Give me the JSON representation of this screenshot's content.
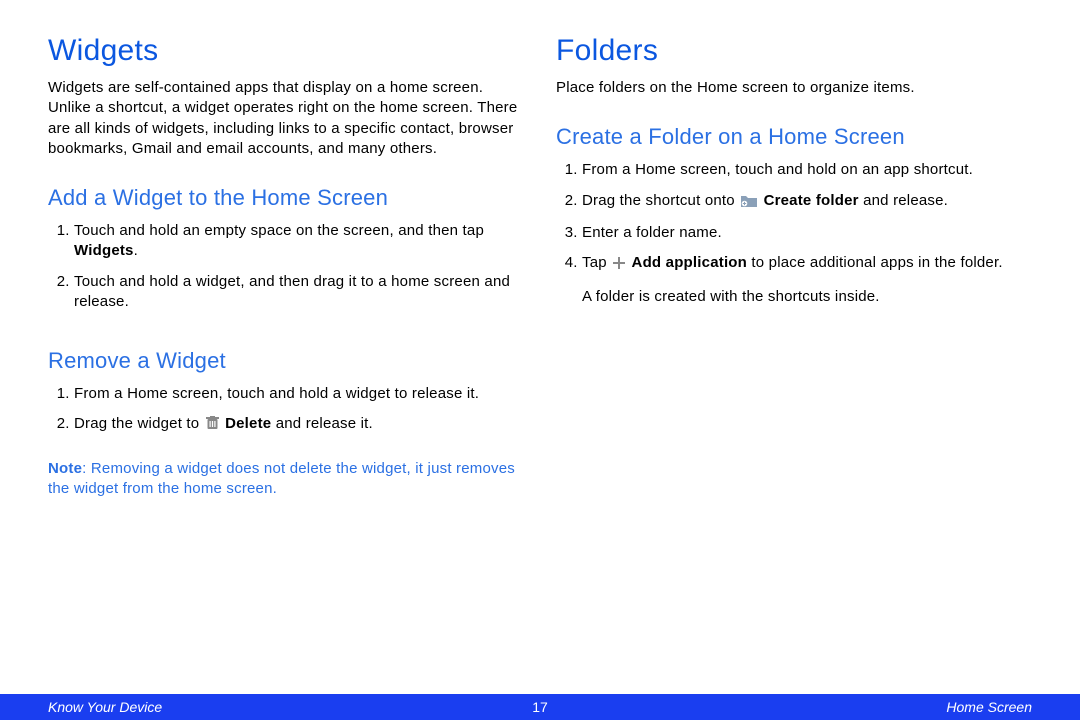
{
  "left": {
    "h1": "Widgets",
    "intro": "Widgets are self-contained apps that display on a home screen. Unlike a shortcut, a widget operates right on the home screen. There are all kinds of widgets, including links to a specific contact, browser bookmarks, Gmail and email accounts, and many others.",
    "sections": [
      {
        "title": "Add a Widget to the Home Screen",
        "items": [
          {
            "pre": "Touch and hold an empty space on the screen, and then tap ",
            "bold": "Widgets",
            "post": "."
          },
          {
            "pre": "Touch and hold a widget, and then drag it to a home screen and release."
          }
        ]
      },
      {
        "title": "Remove a Widget",
        "items": [
          {
            "pre": "From a Home screen, touch and hold a widget to release it."
          },
          {
            "pre": "Drag the widget to ",
            "icon": "trash",
            "bold": "Delete",
            "post": " and release it."
          }
        ],
        "note": {
          "label": "Note",
          "text": ": Removing a widget does not delete the widget, it just removes the widget from the home screen."
        }
      }
    ]
  },
  "right": {
    "h1": "Folders",
    "intro": "Place folders on the Home screen to organize items.",
    "sections": [
      {
        "title": "Create a Folder on a Home Screen",
        "items": [
          {
            "pre": "From a Home screen, touch and hold on an app shortcut."
          },
          {
            "pre": "Drag the shortcut onto ",
            "icon": "folder-plus",
            "bold": "Create folder",
            "post": " and release."
          },
          {
            "pre": "Enter a folder name."
          },
          {
            "pre": "Tap ",
            "icon": "plus",
            "bold": "Add application",
            "post": " to place additional apps in the folder."
          }
        ],
        "sub": "A folder is created with the shortcuts inside."
      }
    ]
  },
  "footer": {
    "left": "Know Your Device",
    "page": "17",
    "right": "Home Screen"
  }
}
